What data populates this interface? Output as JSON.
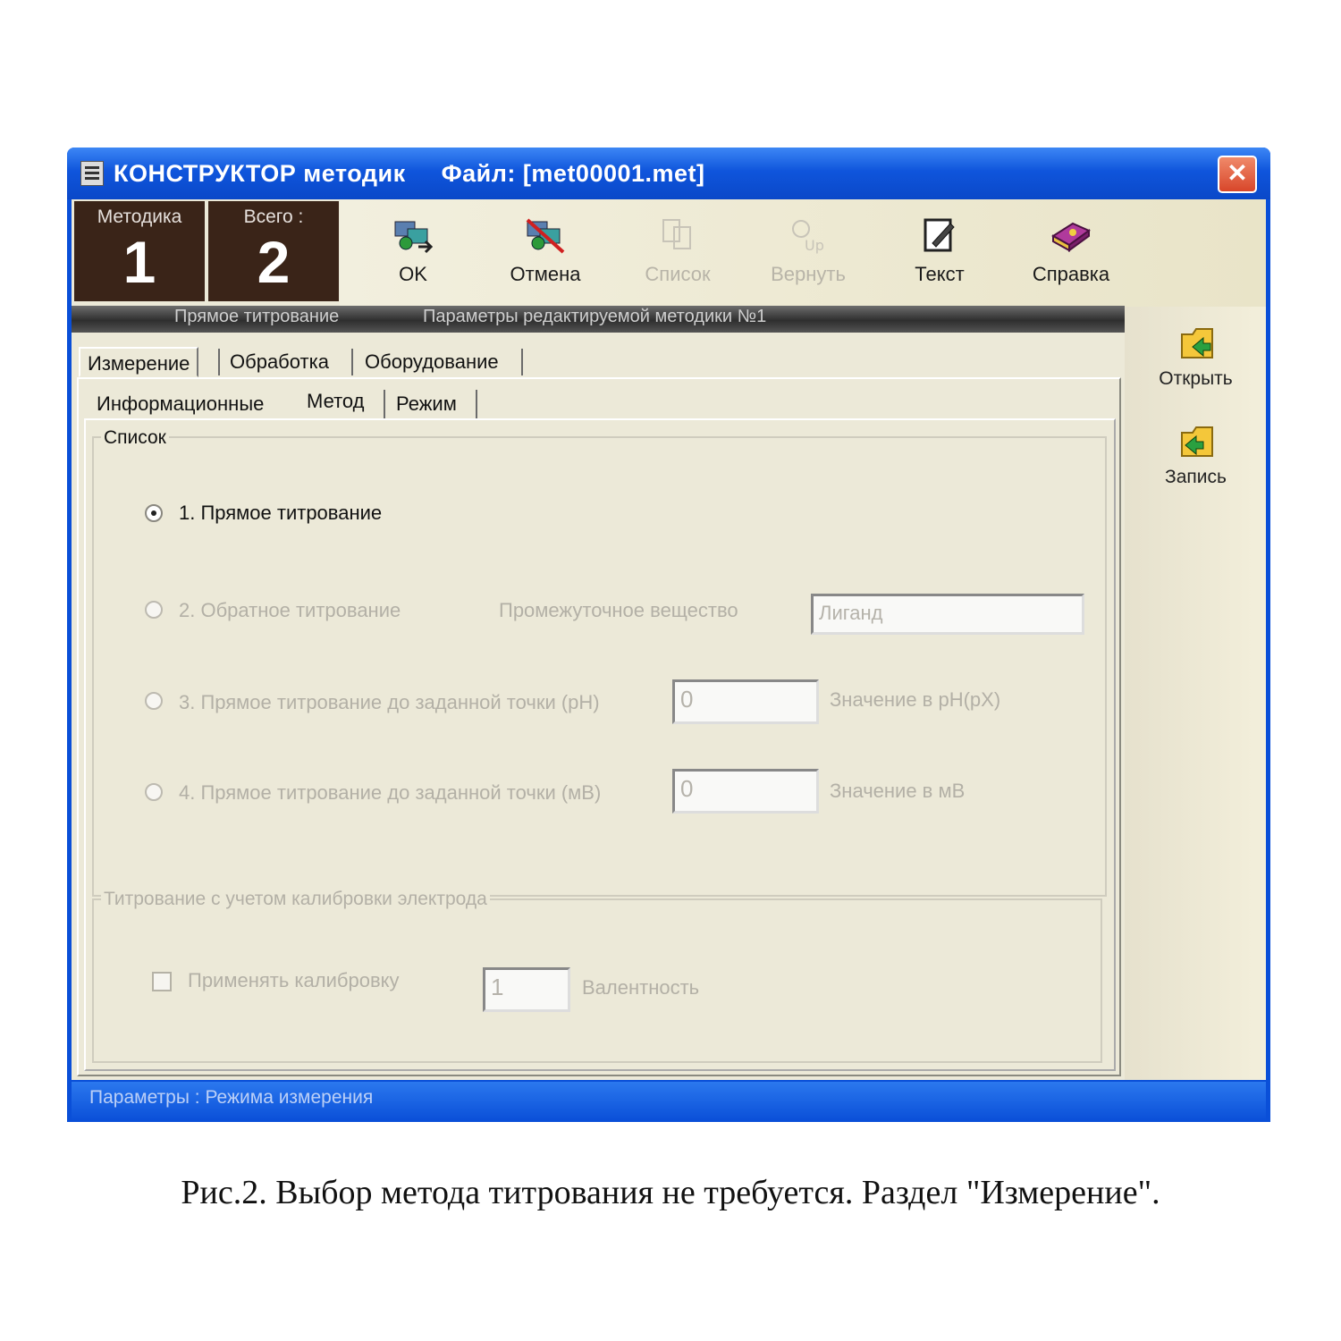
{
  "window": {
    "title": "КОНСТРУКТОР методик     Файл: [met00001.met]",
    "close_symbol": "✕"
  },
  "counters": [
    {
      "label": "Методика",
      "value": "1"
    },
    {
      "label": "Всего :",
      "value": "2"
    }
  ],
  "toolbar": [
    {
      "label": "OK",
      "icon": "ok-icon",
      "enabled": true
    },
    {
      "label": "Отмена",
      "icon": "cancel-icon",
      "enabled": true
    },
    {
      "label": "Список",
      "icon": "list-icon",
      "enabled": false
    },
    {
      "label": "Вернуть",
      "icon": "undo-icon",
      "enabled": false
    },
    {
      "label": "Текст",
      "icon": "text-edit-icon",
      "enabled": true
    },
    {
      "label": "Справка",
      "icon": "help-book-icon",
      "enabled": true
    }
  ],
  "side_buttons": [
    {
      "label": "Открыть",
      "icon": "open-folder-icon"
    },
    {
      "label": "Запись",
      "icon": "save-folder-icon"
    }
  ],
  "strip": {
    "left": "Прямое титрование",
    "right": "Параметры редактируемой методики №1"
  },
  "tabs": [
    "Измерение",
    "Обработка",
    "Оборудование"
  ],
  "subtabs": [
    "Информационные",
    "Метод",
    "Режим"
  ],
  "method_group": {
    "title": "Список",
    "options": [
      {
        "label": "1. Прямое титрование",
        "selected": true,
        "enabled": true
      },
      {
        "label": "2. Обратное титрование",
        "selected": false,
        "enabled": false
      },
      {
        "label": "3. Прямое титрование до заданной точки (pH)",
        "selected": false,
        "enabled": false
      },
      {
        "label": "4. Прямое титрование до заданной точки (мВ)",
        "selected": false,
        "enabled": false
      }
    ],
    "intermediate_label": "Промежуточное вещество",
    "intermediate_value": "Лиганд",
    "ph_value": "0",
    "ph_label": "Значение в pH(pX)",
    "mv_value": "0",
    "mv_label": "Значение в мВ"
  },
  "calibration_group": {
    "title": "Титрование с учетом калибровки электрода",
    "checkbox_label": "Применять калибровку",
    "valence_value": "1",
    "valence_label": "Валентность"
  },
  "status": "Параметры : Режима измерения",
  "caption": "Рис.2. Выбор метода титрования не требуется. Раздел \"Измерение\"."
}
